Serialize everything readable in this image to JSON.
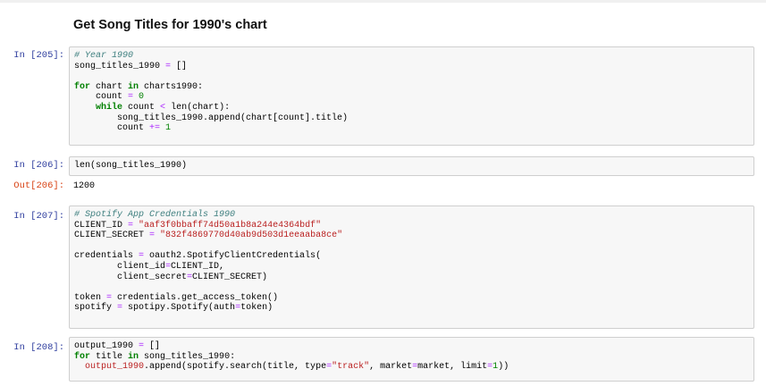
{
  "heading": "Get Song Titles for 1990's chart",
  "cells": [
    {
      "in_prompt": "In [205]:",
      "lines": [
        [
          {
            "t": "# Year 1990",
            "c": "c"
          }
        ],
        [
          {
            "t": "song_titles_1990 "
          },
          {
            "t": "=",
            "c": "o"
          },
          {
            "t": " []"
          }
        ],
        [],
        [
          {
            "t": "for",
            "c": "k"
          },
          {
            "t": " chart "
          },
          {
            "t": "in",
            "c": "k"
          },
          {
            "t": " charts1990:"
          }
        ],
        [
          {
            "t": "    count "
          },
          {
            "t": "=",
            "c": "o"
          },
          {
            "t": " "
          },
          {
            "t": "0",
            "c": "n"
          }
        ],
        [
          {
            "t": "    "
          },
          {
            "t": "while",
            "c": "k"
          },
          {
            "t": " count "
          },
          {
            "t": "<",
            "c": "o"
          },
          {
            "t": " len(chart):"
          }
        ],
        [
          {
            "t": "        song_titles_1990.append(chart[count].title)"
          }
        ],
        [
          {
            "t": "        count "
          },
          {
            "t": "+=",
            "c": "o"
          },
          {
            "t": " "
          },
          {
            "t": "1",
            "c": "n"
          }
        ]
      ]
    },
    {
      "in_prompt": "In [206]:",
      "lines": [
        [
          {
            "t": "len(song_titles_1990)"
          }
        ]
      ],
      "out_prompt": "Out[206]:",
      "output": "1200"
    },
    {
      "in_prompt": "In [207]:",
      "lines": [
        [
          {
            "t": "# Spotify App Credentials 1990",
            "c": "c"
          }
        ],
        [
          {
            "t": "CLIENT_ID "
          },
          {
            "t": "=",
            "c": "o"
          },
          {
            "t": " "
          },
          {
            "t": "\"aaf3f0bbaff74d50a1b8a244e4364bdf\"",
            "c": "s"
          }
        ],
        [
          {
            "t": "CLIENT_SECRET "
          },
          {
            "t": "=",
            "c": "o"
          },
          {
            "t": " "
          },
          {
            "t": "\"832f4869770d40ab9d503d1eeaaba8ce\"",
            "c": "s"
          }
        ],
        [],
        [
          {
            "t": "credentials "
          },
          {
            "t": "=",
            "c": "o"
          },
          {
            "t": " oauth2.SpotifyClientCredentials("
          }
        ],
        [
          {
            "t": "        client_id"
          },
          {
            "t": "=",
            "c": "o"
          },
          {
            "t": "CLIENT_ID,"
          }
        ],
        [
          {
            "t": "        client_secret"
          },
          {
            "t": "=",
            "c": "o"
          },
          {
            "t": "CLIENT_SECRET)"
          }
        ],
        [],
        [
          {
            "t": "token "
          },
          {
            "t": "=",
            "c": "o"
          },
          {
            "t": " credentials.get_access_token()"
          }
        ],
        [
          {
            "t": "spotify "
          },
          {
            "t": "=",
            "c": "o"
          },
          {
            "t": " spotipy.Spotify(auth"
          },
          {
            "t": "=",
            "c": "o"
          },
          {
            "t": "token)"
          }
        ]
      ]
    },
    {
      "in_prompt": "In [208]:",
      "lines": [
        [
          {
            "t": "output_1990 "
          },
          {
            "t": "=",
            "c": "o"
          },
          {
            "t": " []"
          }
        ],
        [
          {
            "t": "for",
            "c": "k"
          },
          {
            "t": " title "
          },
          {
            "t": "in",
            "c": "k"
          },
          {
            "t": " song_titles_1990:"
          }
        ],
        [
          {
            "t": "  "
          },
          {
            "t": "output_1990",
            "c": "v"
          },
          {
            "t": ".append(spotify.search(title, type"
          },
          {
            "t": "=",
            "c": "o"
          },
          {
            "t": "\"track\"",
            "c": "s"
          },
          {
            "t": ", market"
          },
          {
            "t": "=",
            "c": "o"
          },
          {
            "t": "market, limit"
          },
          {
            "t": "=",
            "c": "o"
          },
          {
            "t": "1",
            "c": "n"
          },
          {
            "t": "))"
          }
        ]
      ]
    }
  ]
}
